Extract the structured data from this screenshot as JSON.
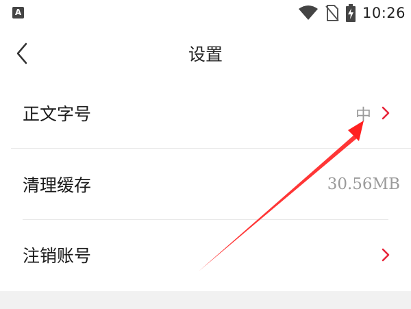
{
  "status_bar": {
    "notification_letter": "A",
    "time": "10:26",
    "icons": [
      "wifi-icon",
      "no-sim-icon",
      "battery-charging-icon"
    ]
  },
  "header": {
    "back_icon": "chevron-left-icon",
    "title": "设置"
  },
  "settings": {
    "items": [
      {
        "label": "正文字号",
        "value": "中",
        "has_chevron": true
      },
      {
        "label": "清理缓存",
        "value": "30.56MB",
        "has_chevron": false
      },
      {
        "label": "注销账号",
        "value": "",
        "has_chevron": true
      }
    ]
  },
  "colors": {
    "accent": "#e8253a",
    "annotation_arrow": "#ff2020",
    "divider": "#e8e8e8",
    "background": "#ffffff",
    "bottom_band": "#f1f1f1"
  }
}
